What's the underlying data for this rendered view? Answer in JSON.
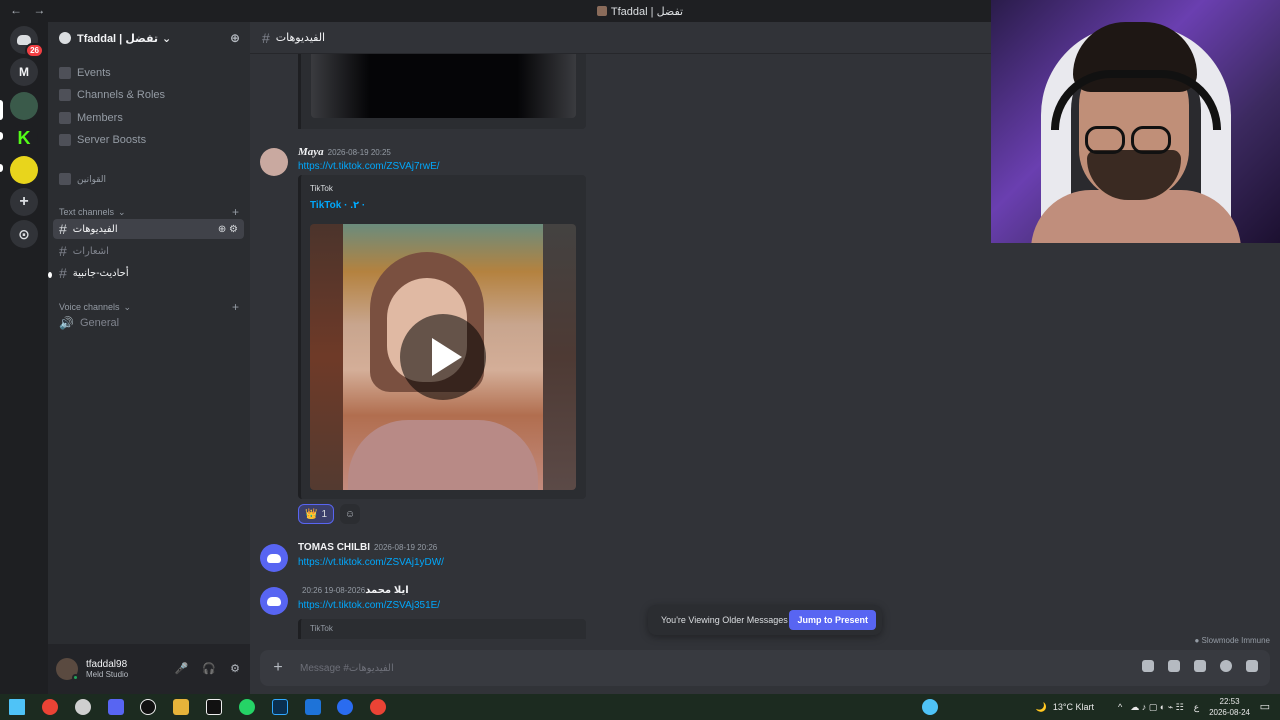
{
  "window": {
    "title": "Tfaddal | تفضل",
    "nav_back": "←",
    "nav_forward": "→"
  },
  "guilds": {
    "dm_badge": "26",
    "items": [
      "M",
      "K",
      "+",
      "⊙"
    ]
  },
  "server": {
    "name": "Tfaddal | تفضل",
    "menu": [
      {
        "label": "Events"
      },
      {
        "label": "Channels & Roles"
      },
      {
        "label": "Members"
      },
      {
        "label": "Server Boosts"
      },
      {
        "label": "القوانين"
      }
    ],
    "text_category": "Text channels",
    "text_channels": [
      {
        "label": "الفيديوهات",
        "active": true
      },
      {
        "label": "اشعارات",
        "active": false
      },
      {
        "label": "أحاديث-جانبية",
        "active": false
      }
    ],
    "voice_category": "Voice channels",
    "voice_channels": [
      {
        "label": "General"
      }
    ]
  },
  "user": {
    "name": "tfaddal98",
    "status": "Meld Studio"
  },
  "channel": {
    "name": "الفيديوهات",
    "placeholder": "Message #الفيديوهات"
  },
  "messages": [
    {
      "author": "Maya",
      "timestamp": "2026-08-19 20:25",
      "link": "https://vt.tiktok.com/ZSVAj7rwE/"
    },
    {
      "author": "TOMAS CHILBI",
      "timestamp": "2026-08-19 20:26",
      "link": "https://vt.tiktok.com/ZSVAj1yDW/"
    },
    {
      "author": "ايلا محمد",
      "timestamp": "2026-08-19 20:26",
      "link": "https://vt.tiktok.com/ZSVAj351E/"
    }
  ],
  "embed": {
    "provider": "TikTok",
    "title": "TikTok · .٢ ·",
    "bottom_provider": "TikTok"
  },
  "reactions": [
    {
      "emoji": "👑",
      "count": "1"
    }
  ],
  "jump": {
    "text": "You're Viewing Older Messages",
    "button": "Jump to Present"
  },
  "slowmode": "Slowmode Immune",
  "taskbar": {
    "weather": "13°C  Klart",
    "lang": "ع",
    "time": "22:53",
    "date": "2026-08-24",
    "notif_count": "9"
  },
  "colors": {
    "blurple": "#5865f2",
    "link": "#00a8fc",
    "sidebar": "#2b2d31",
    "chat": "#313338"
  }
}
